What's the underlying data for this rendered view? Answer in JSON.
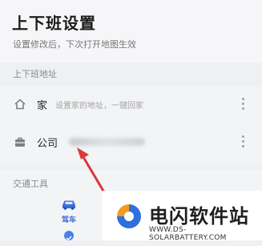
{
  "header": {
    "title": "上下班设置",
    "subtitle": "设置修改后，下次打开地图生效"
  },
  "commute_section": {
    "label": "上下班地址",
    "home": {
      "label": "家",
      "placeholder": "设置家的地址，一键回家",
      "icon": "home-icon"
    },
    "company": {
      "label": "公司",
      "icon": "briefcase-icon"
    }
  },
  "transport_section": {
    "label": "交通工具",
    "modes": [
      {
        "label": "驾车",
        "icon": "car-icon",
        "selected": true
      }
    ]
  },
  "watermark": {
    "title": "电闪软件站",
    "url": "WWW.DS-SOLARBATTERY.COM"
  },
  "colors": {
    "accent": "#3b6fd8",
    "arrow": "#d93a3a",
    "logo_orange": "#f29a1f",
    "logo_blue": "#2f6fde"
  }
}
